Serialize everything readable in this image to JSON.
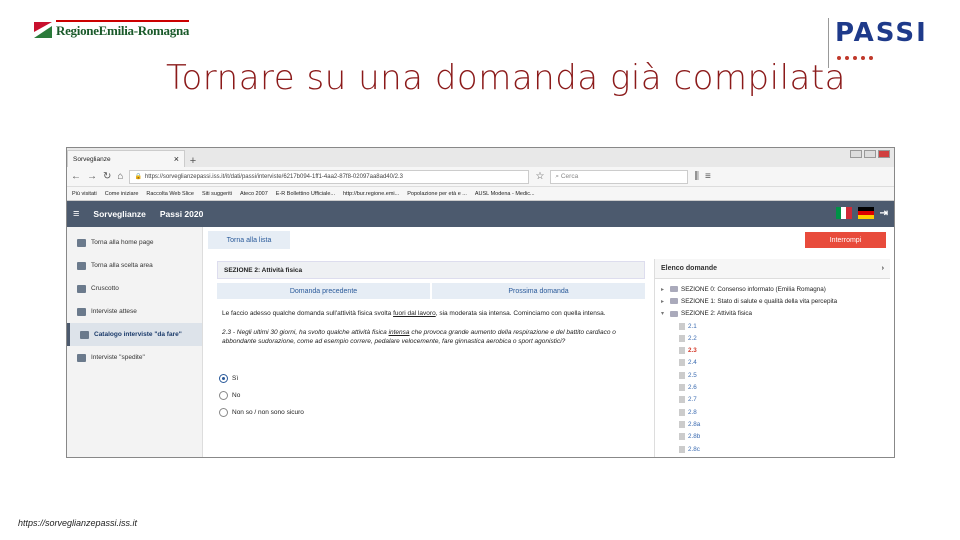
{
  "slide": {
    "title": "Tornare su una domanda già compilata",
    "logo_rer": "RegioneEmilia-Romagna",
    "logo_passi": "PASSI",
    "footer_url": "https://sorveglianzepassi.iss.it"
  },
  "browser": {
    "tab_title": "Sorveglianze",
    "tab_close": "×",
    "new_tab": "+",
    "address": "https://sorveglianzepassi.iss.it/it/dati/passi/interviste/6217b094-1ff1-4aa2-87f8-02097aa8ad40/2.3",
    "search_placeholder": "Cerca",
    "bookmarks": [
      "Più visitati",
      "Come iniziare",
      "Raccolta Web Slice",
      "Siti suggeriti",
      "Ateco 2007",
      "E-R Bollettino Ufficiale...",
      "http://bur.regione.emi...",
      "Popolazione per età e ...",
      "AUSL Modena - Medic..."
    ]
  },
  "app": {
    "brand": "Sorveglianze",
    "section": "Passi 2020",
    "sidebar": [
      {
        "label": "Torna alla home page"
      },
      {
        "label": "Torna alla scelta area"
      },
      {
        "label": "Cruscotto"
      },
      {
        "label": "Interviste attese"
      },
      {
        "label": "Catalogo interviste \"da fare\""
      },
      {
        "label": "Interviste \"spedite\""
      }
    ],
    "back_to_list": "Torna alla lista",
    "interrupt": "Interrompi",
    "section_title": "SEZIONE 2: Attività fisica",
    "prev_question": "Domanda precedente",
    "next_question": "Prossima domanda",
    "intro_a": "Le faccio adesso qualche domanda sull'attività fisica svolta ",
    "intro_u": "fuori dal lavoro",
    "intro_b": ", sia moderata sia intensa. Cominciamo con quella intensa.",
    "question_a": "2.3 - Negli ultimi 30 giorni, ha svolto qualche attività fisica ",
    "question_u": "intensa",
    "question_b": " che provoca grande aumento della respirazione e del battito cardiaco o abbondante sudorazione, come ad esempio correre, pedalare velocemente, fare ginnastica aerobica o sport agonistici?",
    "options": [
      "Sì",
      "No",
      "Non so / non sono sicuro"
    ],
    "elenco_title": "Elenco domande",
    "sections": [
      "SEZIONE 0: Consenso informato (Emilia Romagna)",
      "SEZIONE 1: Stato di salute e qualità della vita percepita",
      "SEZIONE 2: Attività fisica"
    ],
    "questions": [
      "2.1",
      "2.2",
      "2.3",
      "2.4",
      "2.5",
      "2.6",
      "2.7",
      "2.8",
      "2.8a",
      "2.8b",
      "2.8c"
    ]
  }
}
